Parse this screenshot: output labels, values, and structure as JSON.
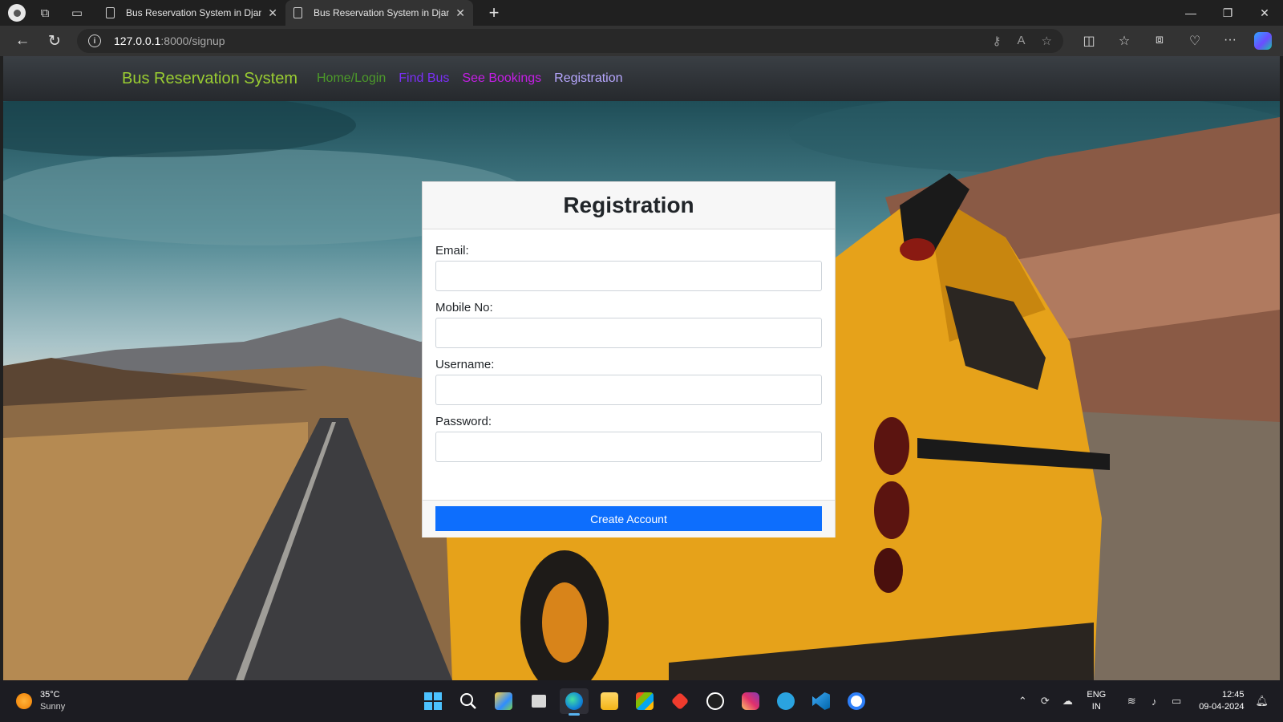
{
  "browser": {
    "tabs": [
      {
        "title": "Bus Reservation System in Djang",
        "active": false
      },
      {
        "title": "Bus Reservation System in Djang",
        "active": true
      }
    ],
    "url_host": "127.0.0.1",
    "url_path": ":8000/signup"
  },
  "navbar": {
    "brand": "Bus Reservation System",
    "links": {
      "home": "Home/Login",
      "find": "Find Bus",
      "bookings": "See Bookings",
      "registration": "Registration"
    }
  },
  "form": {
    "title": "Registration",
    "email_label": "Email:",
    "mobile_label": "Mobile No:",
    "username_label": "Username:",
    "password_label": "Password:",
    "email_value": "",
    "mobile_value": "",
    "username_value": "",
    "password_value": "",
    "submit_label": "Create Account"
  },
  "taskbar": {
    "temperature": "35°C",
    "condition": "Sunny",
    "lang_top": "ENG",
    "lang_bottom": "IN",
    "time": "12:45",
    "date": "09-04-2024"
  },
  "colors": {
    "brand": "#9acd32",
    "primary_button": "#0d6efd",
    "bus": "#e6a21a"
  }
}
